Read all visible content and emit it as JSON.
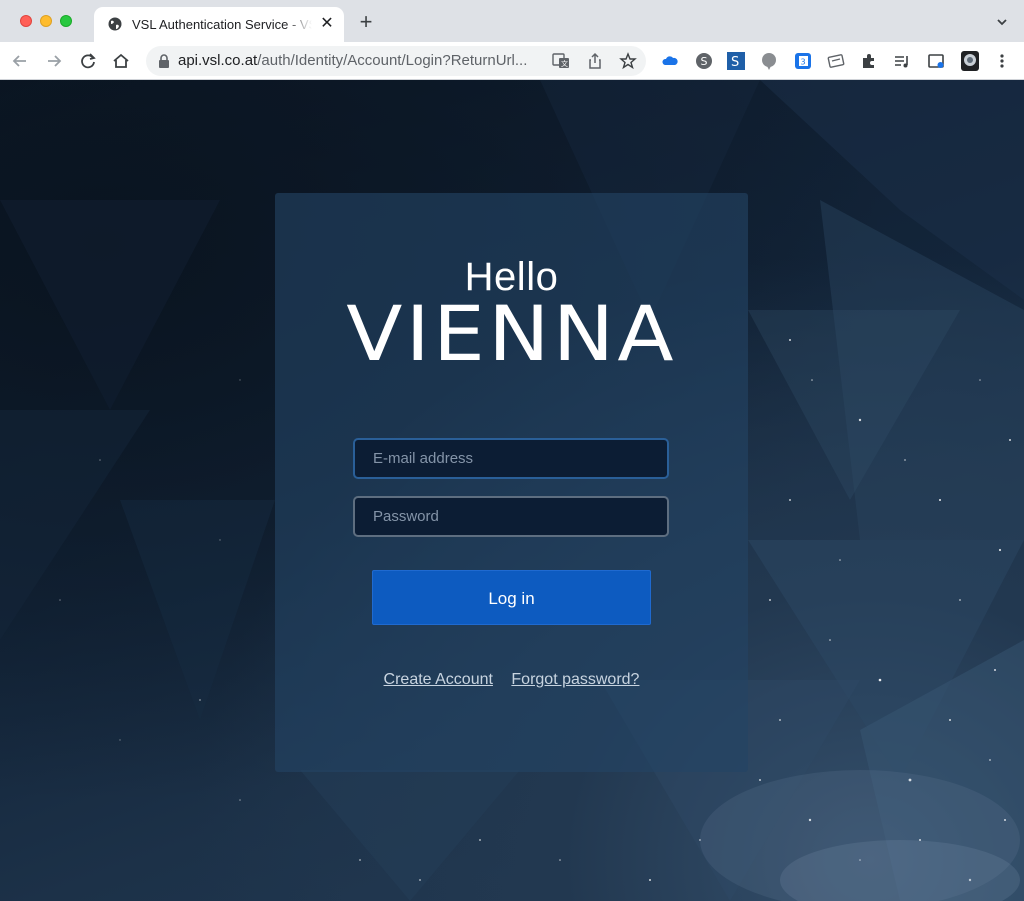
{
  "browser": {
    "tab": {
      "title": "VSL Authentication Service - VSL"
    },
    "address_bar": {
      "host": "api.vsl.co.at",
      "path": "/auth/Identity/Account/Login?ReturnUrl..."
    }
  },
  "login_card": {
    "greeting": "Hello",
    "brand": "VIENNA",
    "email": {
      "placeholder": "E-mail address",
      "value": ""
    },
    "password": {
      "placeholder": "Password",
      "value": ""
    },
    "login_button": "Log in",
    "create_account_link": "Create Account",
    "forgot_password_link": "Forgot password?"
  },
  "colors": {
    "login_button": "#0d5bc0",
    "card_background": "#244464",
    "page_background": "#0b1626"
  }
}
